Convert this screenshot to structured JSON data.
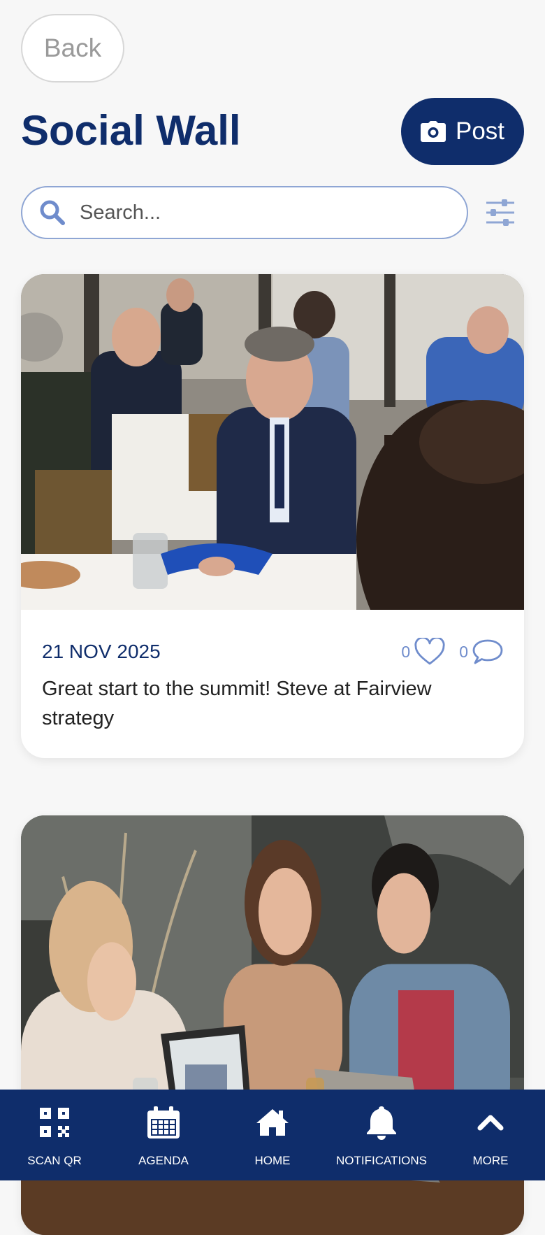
{
  "header": {
    "back_label": "Back",
    "title": "Social Wall",
    "post_label": "Post"
  },
  "search": {
    "placeholder": "Search...",
    "value": ""
  },
  "posts": [
    {
      "date": "21 NOV 2025",
      "likes": "0",
      "comments": "0",
      "text": "Great start to the summit! Steve at Fairview strategy",
      "image": "business-lunch-photo"
    },
    {
      "image": "cafe-meeting-photo"
    }
  ],
  "nav": {
    "items": [
      {
        "label": "SCAN QR",
        "icon": "qr-code-icon"
      },
      {
        "label": "AGENDA",
        "icon": "calendar-icon"
      },
      {
        "label": "HOME",
        "icon": "home-icon"
      },
      {
        "label": "NOTIFICATIONS",
        "icon": "bell-icon"
      },
      {
        "label": "MORE",
        "icon": "chevron-up-icon"
      }
    ]
  },
  "colors": {
    "brand": "#0f2d6b",
    "accent_light": "#6f8ccc",
    "search_border": "#8fa6d4"
  }
}
